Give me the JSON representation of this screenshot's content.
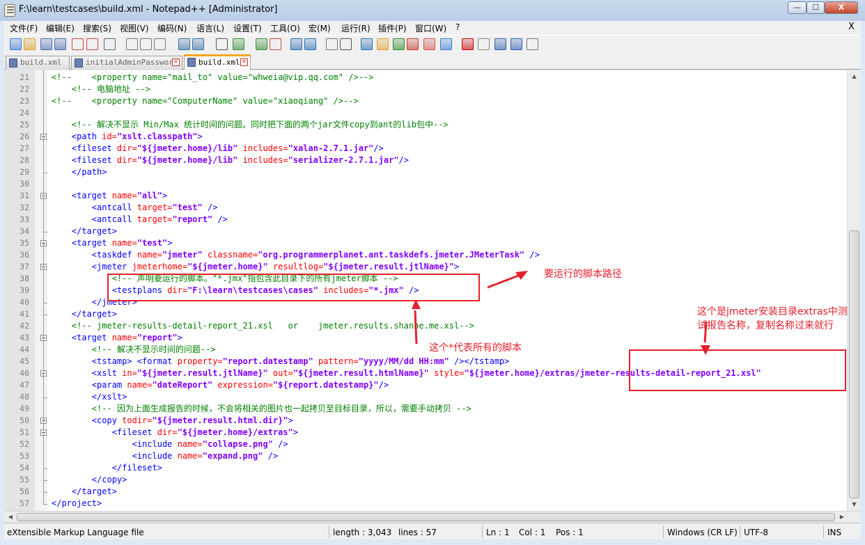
{
  "window": {
    "title": "F:\\learn\\testcases\\build.xml - Notepad++ [Administrator]",
    "minimize_label": "—",
    "maximize_label": "☐",
    "close_label": "X"
  },
  "menu": [
    "文件(F)",
    "编辑(E)",
    "搜索(S)",
    "视图(V)",
    "编码(N)",
    "语言(L)",
    "设置(T)",
    "工具(O)",
    "宏(M)",
    "运行(R)",
    "插件(P)",
    "窗口(W)",
    "?"
  ],
  "menu_close": "X",
  "toolbar_icons": [
    "new-file-icon",
    "open-file-icon",
    "save-icon",
    "save-all-icon",
    "close-icon",
    "close-all-icon",
    "print-icon",
    "cut-icon",
    "copy-icon",
    "paste-icon",
    "undo-icon",
    "redo-icon",
    "find-icon",
    "replace-icon",
    "zoom-in-icon",
    "zoom-out-icon",
    "sync-v-icon",
    "sync-h-icon",
    "word-wrap-icon",
    "show-all-chars-icon",
    "indent-guide-icon",
    "user-lang-icon",
    "doc-map-icon",
    "function-list-icon",
    "folder-icon",
    "monitor-icon",
    "record-macro-icon",
    "stop-record-icon",
    "play-macro-icon",
    "run-macro-multiple-icon",
    "save-macro-icon"
  ],
  "tabs": [
    {
      "label": "build.xml",
      "active": false
    },
    {
      "label": "initialAdminPassword",
      "active": false
    },
    {
      "label": "build.xml",
      "active": true
    }
  ],
  "editor": {
    "lines": [
      {
        "n": "21",
        "fold": "",
        "segs": [
          {
            "t": "<!--    <property name=\"mail_to\" value=\"whweia@vip.qq.com\" />-->",
            "c": "c-com"
          }
        ]
      },
      {
        "n": "22",
        "fold": "",
        "segs": [
          {
            "t": "    <!-- 电脑地址 -->",
            "c": "c-com"
          }
        ]
      },
      {
        "n": "23",
        "fold": "",
        "segs": [
          {
            "t": "<!--    <property name=\"ComputerName\" value=\"xiaoqiang\" />-->",
            "c": "c-com"
          }
        ]
      },
      {
        "n": "24",
        "fold": "",
        "segs": []
      },
      {
        "n": "25",
        "fold": "",
        "segs": [
          {
            "t": "    <!-- 解决不显示 Min/Max 统计时间的问题。同时把下面的两个jar文件copy到ant的lib包中-->",
            "c": "c-com"
          }
        ]
      },
      {
        "n": "26",
        "fold": "open",
        "segs": [
          {
            "t": "    <path ",
            "c": "c-tag"
          },
          {
            "t": "id=",
            "c": "c-attr"
          },
          {
            "t": "\"xslt.classpath\"",
            "c": "c-val"
          },
          {
            "t": ">",
            "c": "c-tag"
          }
        ]
      },
      {
        "n": "27",
        "fold": "",
        "segs": [
          {
            "t": "    <fileset ",
            "c": "c-tag"
          },
          {
            "t": "dir=",
            "c": "c-attr"
          },
          {
            "t": "\"${jmeter.home}/lib\" ",
            "c": "c-val"
          },
          {
            "t": "includes=",
            "c": "c-attr"
          },
          {
            "t": "\"xalan-2.7.1.jar\"",
            "c": "c-val"
          },
          {
            "t": "/>",
            "c": "c-tag"
          }
        ]
      },
      {
        "n": "28",
        "fold": "",
        "segs": [
          {
            "t": "    <fileset ",
            "c": "c-tag"
          },
          {
            "t": "dir=",
            "c": "c-attr"
          },
          {
            "t": "\"${jmeter.home}/lib\" ",
            "c": "c-val"
          },
          {
            "t": "includes=",
            "c": "c-attr"
          },
          {
            "t": "\"serializer-2.7.1.jar\"",
            "c": "c-val"
          },
          {
            "t": "/>",
            "c": "c-tag"
          }
        ]
      },
      {
        "n": "29",
        "fold": "end",
        "segs": [
          {
            "t": "    </path>",
            "c": "c-tag"
          }
        ]
      },
      {
        "n": "30",
        "fold": "",
        "segs": []
      },
      {
        "n": "31",
        "fold": "open",
        "segs": [
          {
            "t": "    <target ",
            "c": "c-tag"
          },
          {
            "t": "name=",
            "c": "c-attr"
          },
          {
            "t": "\"all\"",
            "c": "c-val"
          },
          {
            "t": ">",
            "c": "c-tag"
          }
        ]
      },
      {
        "n": "32",
        "fold": "",
        "segs": [
          {
            "t": "        <antcall ",
            "c": "c-tag"
          },
          {
            "t": "target=",
            "c": "c-attr"
          },
          {
            "t": "\"test\" ",
            "c": "c-val"
          },
          {
            "t": "/>",
            "c": "c-tag"
          }
        ]
      },
      {
        "n": "33",
        "fold": "",
        "segs": [
          {
            "t": "        <antcall ",
            "c": "c-tag"
          },
          {
            "t": "target=",
            "c": "c-attr"
          },
          {
            "t": "\"report\" ",
            "c": "c-val"
          },
          {
            "t": "/>",
            "c": "c-tag"
          }
        ]
      },
      {
        "n": "34",
        "fold": "end",
        "segs": [
          {
            "t": "    </target>",
            "c": "c-tag"
          }
        ]
      },
      {
        "n": "35",
        "fold": "open",
        "segs": [
          {
            "t": "    <target ",
            "c": "c-tag"
          },
          {
            "t": "name=",
            "c": "c-attr"
          },
          {
            "t": "\"test\"",
            "c": "c-val"
          },
          {
            "t": ">",
            "c": "c-tag"
          }
        ]
      },
      {
        "n": "36",
        "fold": "",
        "segs": [
          {
            "t": "        <taskdef ",
            "c": "c-tag"
          },
          {
            "t": "name=",
            "c": "c-attr"
          },
          {
            "t": "\"jmeter\" ",
            "c": "c-val"
          },
          {
            "t": "classname=",
            "c": "c-attr"
          },
          {
            "t": "\"org.programmerplanet.ant.taskdefs.jmeter.JMeterTask\" ",
            "c": "c-val"
          },
          {
            "t": "/>",
            "c": "c-tag"
          }
        ]
      },
      {
        "n": "37",
        "fold": "open",
        "segs": [
          {
            "t": "        <jmeter ",
            "c": "c-tag"
          },
          {
            "t": "jmeterhome=",
            "c": "c-attr"
          },
          {
            "t": "\"${jmeter.home}\" ",
            "c": "c-val"
          },
          {
            "t": "resultlog=",
            "c": "c-attr"
          },
          {
            "t": "\"${jmeter.result.jtlName}\"",
            "c": "c-val"
          },
          {
            "t": ">",
            "c": "c-tag"
          }
        ]
      },
      {
        "n": "38",
        "fold": "",
        "segs": [
          {
            "t": "            <!-- 声明要运行的脚本。\"*.jmx\"指包含此目录下的所有jmeter脚本 -->",
            "c": "c-com"
          }
        ]
      },
      {
        "n": "39",
        "fold": "",
        "segs": [
          {
            "t": "            <testplans ",
            "c": "c-tag"
          },
          {
            "t": "dir=",
            "c": "c-attr"
          },
          {
            "t": "\"F:\\learn\\testcases\\cases\" ",
            "c": "c-val"
          },
          {
            "t": "includes=",
            "c": "c-attr"
          },
          {
            "t": "\"*.jmx\" ",
            "c": "c-val"
          },
          {
            "t": "/>",
            "c": "c-tag"
          }
        ]
      },
      {
        "n": "40",
        "fold": "end",
        "segs": [
          {
            "t": "        </jmeter>",
            "c": "c-tag"
          }
        ]
      },
      {
        "n": "41",
        "fold": "end",
        "segs": [
          {
            "t": "    </target>",
            "c": "c-tag"
          }
        ]
      },
      {
        "n": "42",
        "fold": "",
        "segs": [
          {
            "t": "    <!-- jmeter-results-detail-report_21.xsl   or    jmeter.results.shanhe.me.xsl-->",
            "c": "c-com"
          }
        ]
      },
      {
        "n": "43",
        "fold": "open",
        "segs": [
          {
            "t": "    <target ",
            "c": "c-tag"
          },
          {
            "t": "name=",
            "c": "c-attr"
          },
          {
            "t": "\"report\"",
            "c": "c-val"
          },
          {
            "t": ">",
            "c": "c-tag"
          }
        ]
      },
      {
        "n": "44",
        "fold": "",
        "segs": [
          {
            "t": "        <!-- 解决不显示时间的问题-->",
            "c": "c-com"
          }
        ]
      },
      {
        "n": "45",
        "fold": "",
        "segs": [
          {
            "t": "        <tstamp> <format ",
            "c": "c-tag"
          },
          {
            "t": "property=",
            "c": "c-attr"
          },
          {
            "t": "\"report.datestamp\" ",
            "c": "c-val"
          },
          {
            "t": "pattern=",
            "c": "c-attr"
          },
          {
            "t": "\"yyyy/MM/dd HH:mm\" ",
            "c": "c-val"
          },
          {
            "t": "/></tstamp>",
            "c": "c-tag"
          }
        ]
      },
      {
        "n": "46",
        "fold": "open",
        "segs": [
          {
            "t": "        <xslt ",
            "c": "c-tag"
          },
          {
            "t": "in=",
            "c": "c-attr"
          },
          {
            "t": "\"${jmeter.result.jtlName}\" ",
            "c": "c-val"
          },
          {
            "t": "out=",
            "c": "c-attr"
          },
          {
            "t": "\"${jmeter.result.htmlName}\" ",
            "c": "c-val"
          },
          {
            "t": "style=",
            "c": "c-attr"
          },
          {
            "t": "\"${jmeter.home}/extras/jmeter-results-detail-report_21.xsl\"",
            "c": "c-val"
          }
        ]
      },
      {
        "n": "47",
        "fold": "",
        "segs": [
          {
            "t": "        <param ",
            "c": "c-tag"
          },
          {
            "t": "name=",
            "c": "c-attr"
          },
          {
            "t": "\"dateReport\" ",
            "c": "c-val"
          },
          {
            "t": "expression=",
            "c": "c-attr"
          },
          {
            "t": "\"${report.datestamp}\"",
            "c": "c-val"
          },
          {
            "t": "/>",
            "c": "c-tag"
          }
        ]
      },
      {
        "n": "48",
        "fold": "end",
        "segs": [
          {
            "t": "        </xslt>",
            "c": "c-tag"
          }
        ]
      },
      {
        "n": "49",
        "fold": "",
        "segs": [
          {
            "t": "        <!-- 因为上面生成报告的时候，不会将相关的图片也一起拷贝至目标目录，所以，需要手动拷贝 -->",
            "c": "c-com"
          }
        ]
      },
      {
        "n": "50",
        "fold": "open",
        "segs": [
          {
            "t": "        <copy ",
            "c": "c-tag"
          },
          {
            "t": "todir=",
            "c": "c-attr"
          },
          {
            "t": "\"${jmeter.result.html.dir}\"",
            "c": "c-val"
          },
          {
            "t": ">",
            "c": "c-tag"
          }
        ]
      },
      {
        "n": "51",
        "fold": "open",
        "segs": [
          {
            "t": "            <fileset ",
            "c": "c-tag"
          },
          {
            "t": "dir=",
            "c": "c-attr"
          },
          {
            "t": "\"${jmeter.home}/extras\"",
            "c": "c-val"
          },
          {
            "t": ">",
            "c": "c-tag"
          }
        ]
      },
      {
        "n": "52",
        "fold": "",
        "segs": [
          {
            "t": "                <include ",
            "c": "c-tag"
          },
          {
            "t": "name=",
            "c": "c-attr"
          },
          {
            "t": "\"collapse.png\" ",
            "c": "c-val"
          },
          {
            "t": "/>",
            "c": "c-tag"
          }
        ]
      },
      {
        "n": "53",
        "fold": "",
        "segs": [
          {
            "t": "                <include ",
            "c": "c-tag"
          },
          {
            "t": "name=",
            "c": "c-attr"
          },
          {
            "t": "\"expand.png\" ",
            "c": "c-val"
          },
          {
            "t": "/>",
            "c": "c-tag"
          }
        ]
      },
      {
        "n": "54",
        "fold": "end",
        "segs": [
          {
            "t": "            </fileset>",
            "c": "c-tag"
          }
        ]
      },
      {
        "n": "55",
        "fold": "end",
        "segs": [
          {
            "t": "        </copy>",
            "c": "c-tag"
          }
        ]
      },
      {
        "n": "56",
        "fold": "end",
        "segs": [
          {
            "t": "    </target>",
            "c": "c-tag"
          }
        ]
      },
      {
        "n": "57",
        "fold": "last",
        "segs": [
          {
            "t": "</project>",
            "c": "c-tag"
          }
        ]
      }
    ]
  },
  "annotations": {
    "script_path": "要运行的脚本路径",
    "all_scripts": "这个*代表所有的脚本",
    "report_name_1": "这个是jmeter安装目录extras中测",
    "report_name_2": "试报告名称，复制名称过来就行"
  },
  "status": {
    "file_type": "eXtensible Markup Language file",
    "length": "length : 3,043",
    "lines": "lines : 57",
    "ln": "Ln : 1",
    "col": "Col : 1",
    "pos": "Pos : 1",
    "eol": "Windows (CR LF)",
    "encoding": "UTF-8",
    "mode": "INS"
  }
}
